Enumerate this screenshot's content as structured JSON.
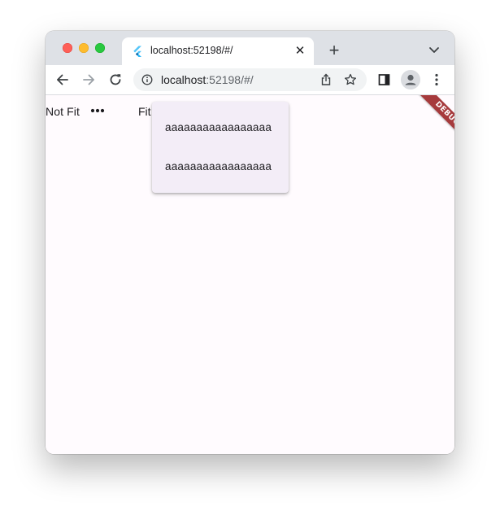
{
  "browser": {
    "tab": {
      "title": "localhost:52198/#/"
    },
    "new_tab_glyph": "+",
    "close_glyph": "✕",
    "omnibox": {
      "host": "localhost",
      "path": ":52198/#/"
    },
    "icons": [
      "flutter-favicon-icon",
      "close-icon",
      "plus-icon",
      "chevron-down-icon",
      "back-arrow-icon",
      "forward-arrow-icon",
      "reload-icon",
      "info-icon",
      "share-icon",
      "star-icon",
      "side-panel-icon",
      "profile-icon",
      "kebab-menu-icon"
    ]
  },
  "app": {
    "not_fit_label": "Not Fit",
    "fit_label": "Fit",
    "menu_items": [
      "aaaaaaaaaaaaaaaaa",
      "aaaaaaaaaaaaaaaaa"
    ],
    "debug_banner": "DEBUG",
    "colors": {
      "background": "#fffbfe",
      "popup_surface": "#f3edf7",
      "debug_banner": "#a63a3c"
    }
  }
}
